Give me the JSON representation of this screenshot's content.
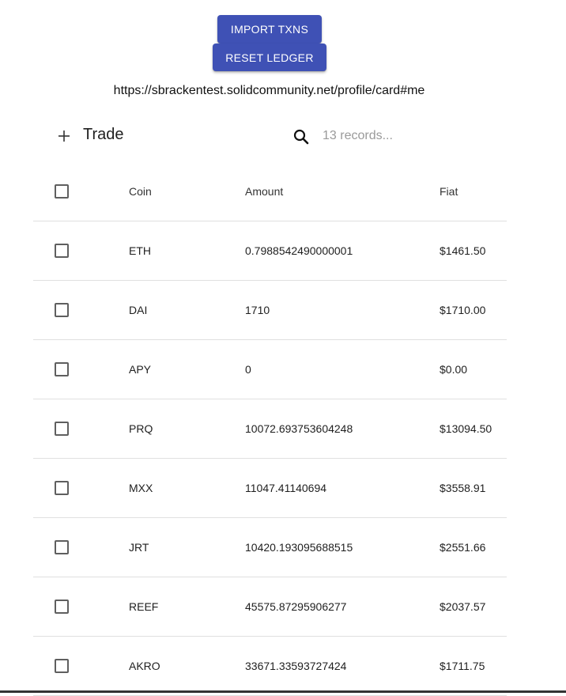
{
  "buttons": {
    "import_label": "IMPORT TXNS",
    "reset_label": "RESET LEDGER"
  },
  "webid": "https://sbrackentest.solidcommunity.net/profile/card#me",
  "toolbar": {
    "title": "Trade",
    "add_icon": "plus-icon",
    "search_icon": "search-icon",
    "search_placeholder": "13 records...",
    "search_value": ""
  },
  "table": {
    "columns": {
      "coin": "Coin",
      "amount": "Amount",
      "fiat": "Fiat"
    },
    "rows": [
      {
        "coin": "ETH",
        "amount": "0.7988542490000001",
        "fiat": "$1461.50"
      },
      {
        "coin": "DAI",
        "amount": "1710",
        "fiat": "$1710.00"
      },
      {
        "coin": "APY",
        "amount": "0",
        "fiat": "$0.00"
      },
      {
        "coin": "PRQ",
        "amount": "10072.693753604248",
        "fiat": "$13094.50"
      },
      {
        "coin": "MXX",
        "amount": "11047.41140694",
        "fiat": "$3558.91"
      },
      {
        "coin": "JRT",
        "amount": "10420.193095688515",
        "fiat": "$2551.66"
      },
      {
        "coin": "REEF",
        "amount": "45575.87295906277",
        "fiat": "$2037.57"
      },
      {
        "coin": "AKRO",
        "amount": "33671.33593727424",
        "fiat": "$1711.75"
      }
    ]
  },
  "colors": {
    "primary": "#3f51b5",
    "divider": "#e0e0e0",
    "placeholder": "#9a9a9a"
  }
}
